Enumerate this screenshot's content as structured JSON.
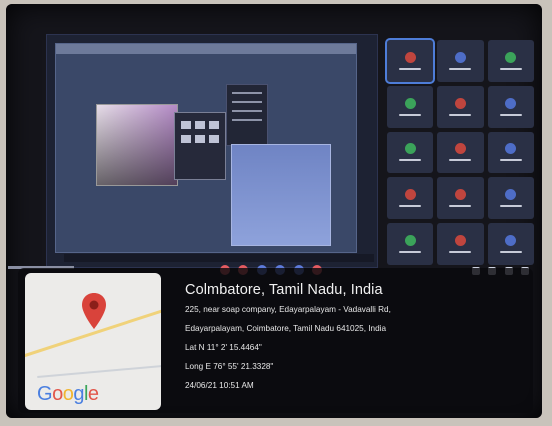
{
  "location": {
    "title": "Colmbatore, Tamil Nadu, India",
    "address_line_1": "225, near soap company, Edayarpalayam - Vadavalli Rd,",
    "address_line_2": "Edayarpalayam, Coimbatore, Tamil Nadu 641025, India",
    "latitude": "Lat N 11° 2' 15.4464\"",
    "longitude": "Long E 76° 55' 21.3328\"",
    "timestamp": "24/06/21 10:51 AM"
  },
  "map": {
    "logo_letters": [
      "G",
      "o",
      "o",
      "g",
      "l",
      "e"
    ],
    "pin_icon": "map-pin-icon",
    "pin_color": "#d9433b"
  },
  "meeting": {
    "participant_avatar_colors": [
      "#c0453e",
      "#4e6dc7",
      "#3ba35a",
      "#3ba35a",
      "#c0453e",
      "#4e6dc7",
      "#3ba35a",
      "#c0453e",
      "#4e6dc7",
      "#c0453e",
      "#c0453e",
      "#4e6dc7",
      "#3ba35a",
      "#c0453e",
      "#4e6dc7"
    ]
  }
}
